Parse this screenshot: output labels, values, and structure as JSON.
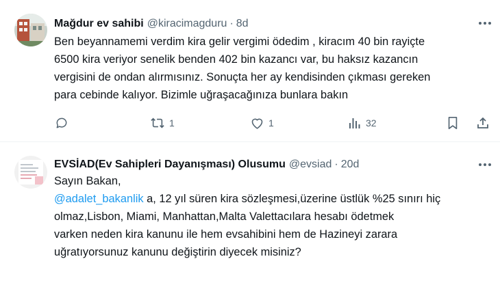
{
  "tweets": [
    {
      "author": {
        "name": "Mağdur ev sahibi",
        "handle": "@kiracimagduru"
      },
      "time": "8d",
      "separator": "·",
      "lines": [
        "Ben beyannamemi verdim kira gelir vergimi ödedim , kiracım 40 bin rayiçte",
        "6500 kira veriyor senelik benden 402 bin kazancı var, bu haksız kazancın",
        "vergisini de ondan alırmısınız. Sonuçta her ay kendisinden çıkması gereken",
        "para cebinde kalıyor. Bizimle uğraşacağınıza bunlara bakın"
      ],
      "actions": {
        "retweets": "1",
        "likes": "1",
        "views": "32"
      },
      "icons": [
        "reply-icon",
        "retweet-icon",
        "like-icon",
        "views-icon",
        "bookmark-icon",
        "share-icon"
      ]
    },
    {
      "author": {
        "name": "EVSİAD(Ev Sahipleri Dayanışması) Olusumu",
        "handle": "@evsiad"
      },
      "time": "20d",
      "separator": "·",
      "lines": [
        "Sayın Bakan,",
        "@adalet_bakanlik",
        "a, 12 yıl süren kira sözleşmesi,üzerine üstlük %25 sınırı hiç",
        "olmaz,Lisbon, Miami, Manhattan,Malta Valettacılara hesabı ödetmek",
        "varken neden kira kanunu ile hem evsahibini hem de Hazineyi zarara",
        "uğratıyorsunuz kanunu değiştirin diyecek misiniz?"
      ]
    }
  ],
  "colors": {
    "text": "#0f1419",
    "secondary": "#536471",
    "link": "#1d9bf0",
    "divider": "#eff3f4"
  }
}
